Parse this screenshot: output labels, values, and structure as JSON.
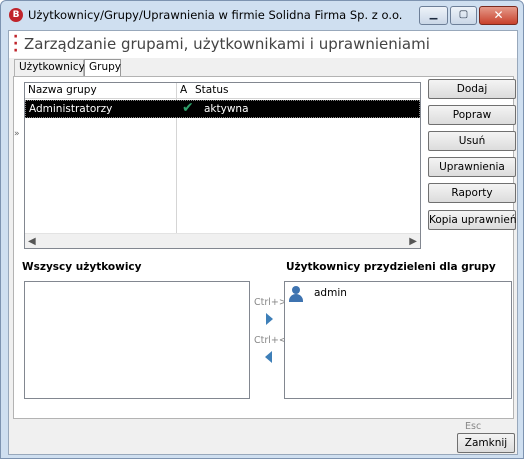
{
  "window": {
    "title": "Użytkownicy/Grupy/Uprawnienia w firmie Solidna Firma Sp. z o.o.",
    "icon_letter": "B"
  },
  "header": {
    "title": "Zarządzanie grupami, użytkownikami i uprawnieniami"
  },
  "tabs": [
    {
      "label": "Użytkownicy"
    },
    {
      "label": "Grupy",
      "active": true
    }
  ],
  "grid": {
    "columns": [
      "Nazwa grupy",
      "A",
      "Status"
    ],
    "rows": [
      {
        "name": "Administratorzy",
        "active": true,
        "status": "aktywna"
      }
    ]
  },
  "buttons": {
    "add": "Dodaj",
    "edit": "Popraw",
    "delete": "Usuń",
    "permissions": "Uprawnienia",
    "reports": "Raporty",
    "copy_permissions": "Kopia uprawnień"
  },
  "all_users": {
    "label": "Wszyscy użytkowicy",
    "items": []
  },
  "assigned_users": {
    "label": "Użytkownicy przydzieleni dla grupy",
    "items": [
      "admin"
    ]
  },
  "shortcuts": {
    "add": "Ctrl+>",
    "remove": "Ctrl+<",
    "close": "Esc"
  },
  "footer": {
    "close_label": "Zamknij"
  },
  "colors": {
    "accent": "#c0242b",
    "check": "#2fa06a",
    "arrow": "#3e7fb8",
    "user_icon": "#3e73b0"
  }
}
